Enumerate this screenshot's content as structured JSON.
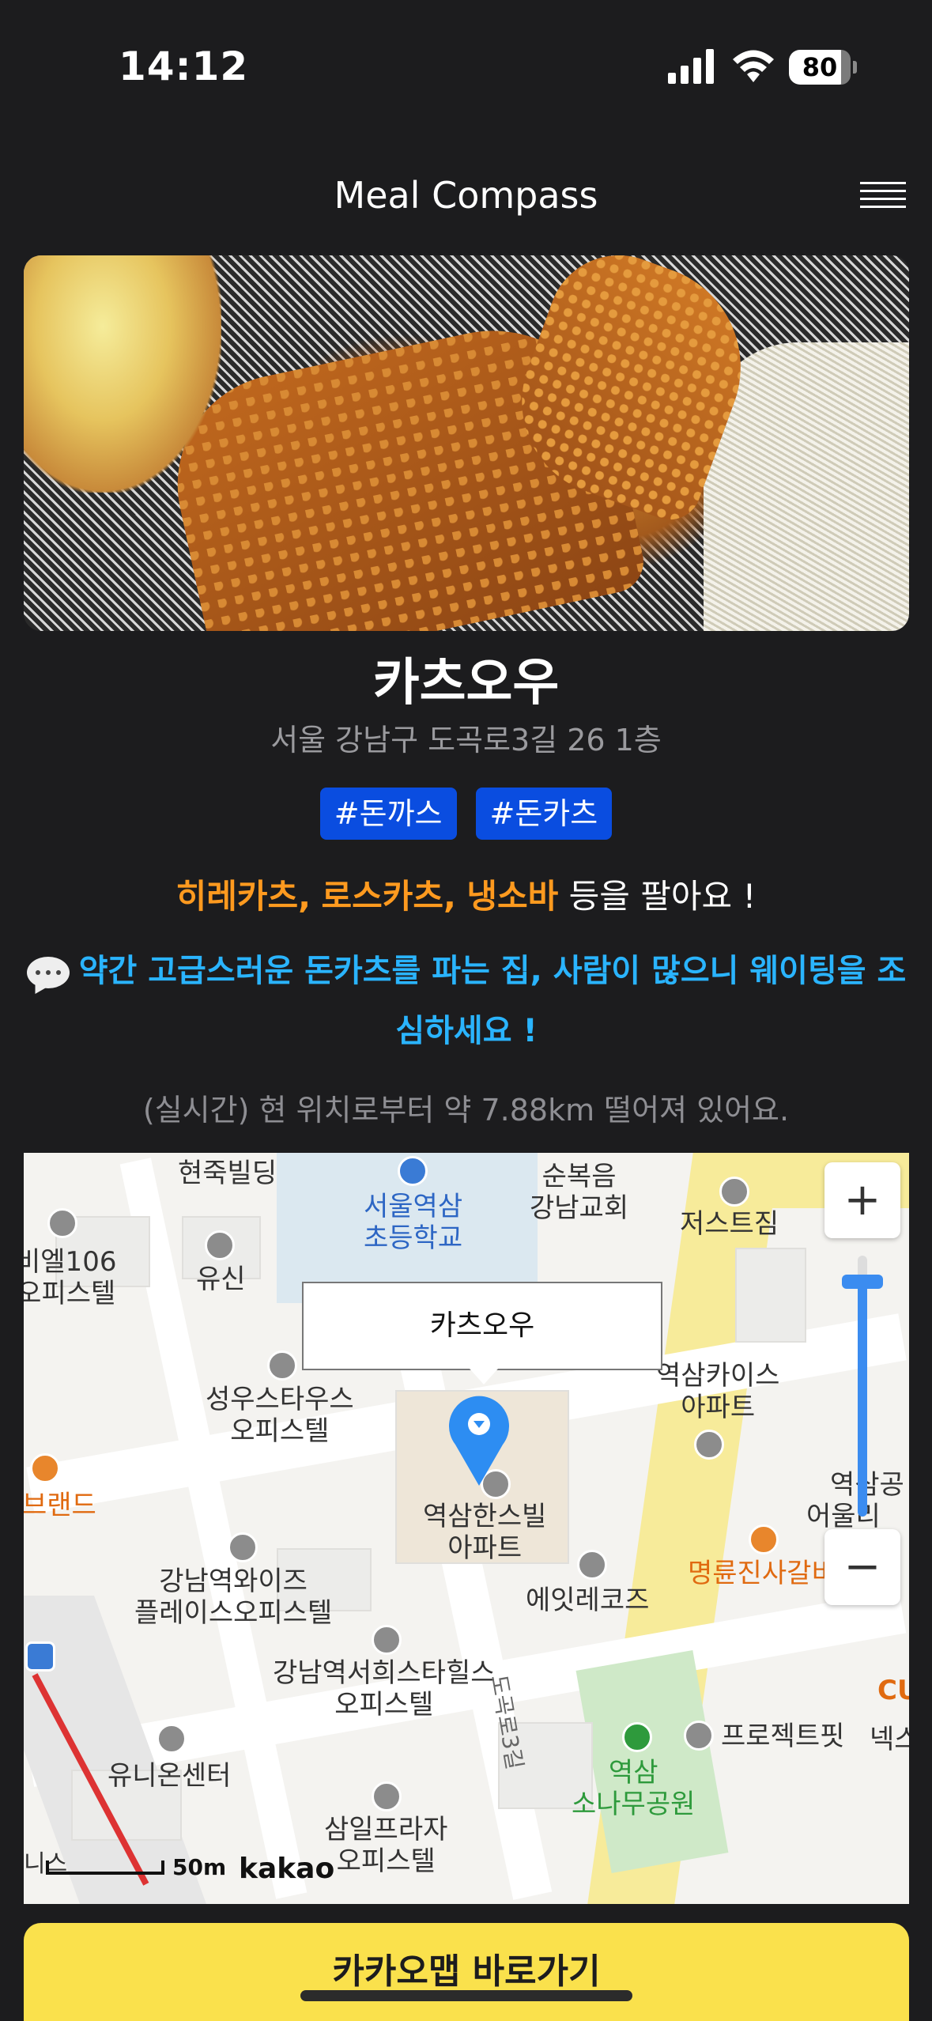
{
  "status_bar": {
    "time": "14:12",
    "battery": "80",
    "icons": [
      "signal-icon",
      "wifi-icon",
      "battery-icon"
    ]
  },
  "header": {
    "title": "Meal Compass",
    "menu_icon": "hamburger-menu-icon"
  },
  "restaurant": {
    "name": "카츠오우",
    "address": "서울 강남구 도곡로3길 26 1층",
    "tags": [
      "#돈까스",
      "#돈카츠"
    ],
    "menu_items": [
      "히레카츠,",
      "로스카츠,",
      "냉소바"
    ],
    "menu_suffix": "등을 팔아요 !",
    "comment": "약간 고급스러운 돈카츠를 파는 집, 사람이 많으니 웨이팅을 조심하세요 !",
    "distance": "(실시간) 현 위치로부터 약 7.88km 떨어져 있어요."
  },
  "map": {
    "infowindow_label": "카츠오우",
    "zoom_in": "+",
    "zoom_out": "−",
    "zoom_level_fraction": 0.9,
    "scale": "50m",
    "logo": "kakao",
    "labels": {
      "hyunjuk": "현죽빌딩",
      "school": "서울역삼\n초등학교",
      "church": "순복음\n강남교회",
      "justgym": "저스트짐",
      "hotel106": "비엘106\n오피스텔",
      "yushin": "유신",
      "seongwoo": "성우스타우스\n오피스텔",
      "yeoksam_kaith": "역삼카이스\n아파트",
      "brand": "브랜드",
      "hansville": "역삼한스빌\n아파트",
      "myeongryun": "명륜진사갈비",
      "gangnam_wise": "강남역와이즈\n플레이스오피스텔",
      "ate_records": "에잇레코즈",
      "gangnam_seohee": "강남역서희스타힐스\n오피스텔",
      "union_center": "유니온센터",
      "project_fit": "프로젝트핏",
      "park": "역삼\n소나무공원",
      "samil": "삼일프라자\n오피스텔",
      "dogok_road": "도곡로3길",
      "cu": "CU",
      "nexus": "넥스",
      "eorigi": "어울리",
      "yeoksamgong": "역삼공",
      "left_bottom": "니스"
    }
  },
  "cta": {
    "label": "카카오맵 바로가기"
  },
  "colors": {
    "background": "#1c1c1e",
    "tag_bg": "#0a4de0",
    "menu_highlight": "#ff9a1f",
    "comment": "#2ab4ff",
    "cta_bg": "#fae14c"
  }
}
